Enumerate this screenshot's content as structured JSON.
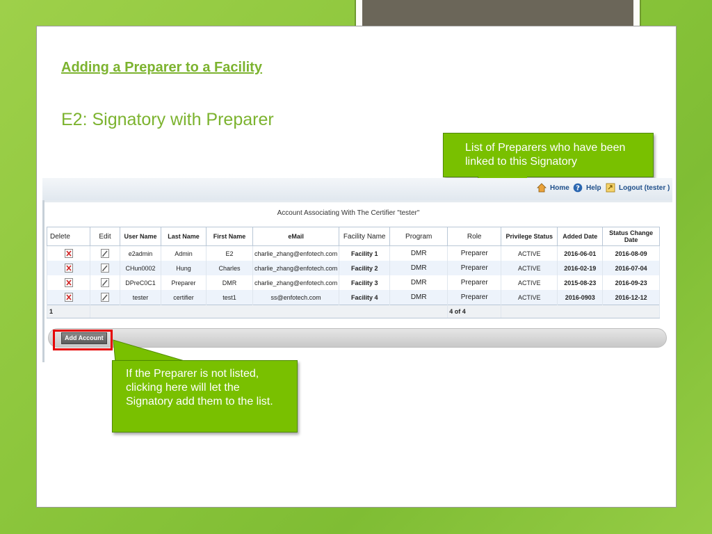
{
  "slide": {
    "title": "Adding a Preparer to a Facility",
    "subtitle": "E2: Signatory with Preparer"
  },
  "callouts": {
    "preparers_list": "List of Preparers who have been linked to this Signatory",
    "add_account_hint": "If the Preparer is not listed, clicking here will let the Signatory add them to the list."
  },
  "app": {
    "nav": {
      "home": "Home",
      "help": "Help",
      "logout": "Logout (tester )"
    },
    "caption": "Account Associating With The Certifier \"tester\"",
    "columns": [
      "Delete",
      "Edit",
      "User Name",
      "Last Name",
      "First Name",
      "eMail",
      "Facility Name",
      "Program",
      "Role",
      "Privilege Status",
      "Added Date",
      "Status Change Date"
    ],
    "rows": [
      {
        "user": "e2admin",
        "last": "Admin",
        "first": "E2",
        "email": "charlie_zhang@enfotech.com",
        "facility": "Facility 1",
        "program": "DMR",
        "role": "Preparer",
        "status": "ACTIVE",
        "added": "2016-06-01",
        "changed": "2016-08-09"
      },
      {
        "user": "CHun0002",
        "last": "Hung",
        "first": "Charles",
        "email": "charlie_zhang@enfotech.com",
        "facility": "Facility 2",
        "program": "DMR",
        "role": "Preparer",
        "status": "ACTIVE",
        "added": "2016-02-19",
        "changed": "2016-07-04"
      },
      {
        "user": "DPreC0C1",
        "last": "Preparer",
        "first": "DMR",
        "email": "charlie_zhang@enfotech.com",
        "facility": "Facility 3",
        "program": "DMR",
        "role": "Preparer",
        "status": "ACTIVE",
        "added": "2015-08-23",
        "changed": "2016-09-23"
      },
      {
        "user": "tester",
        "last": "certifier",
        "first": "test1",
        "email": "ss@enfotech.com",
        "facility": "Facility 4",
        "program": "DMR",
        "role": "Preparer",
        "status": "ACTIVE",
        "added": "2016-0903",
        "changed": "2016-12-12"
      }
    ],
    "footer": {
      "page": "1",
      "count": "4 of 4"
    },
    "add_account": "Add Account"
  },
  "colors": {
    "accent": "#7cb32f",
    "callout": "#79c000",
    "highlight": "#e60000"
  },
  "icons": [
    "home-icon",
    "help-icon",
    "logout-icon",
    "delete-icon",
    "edit-icon"
  ]
}
